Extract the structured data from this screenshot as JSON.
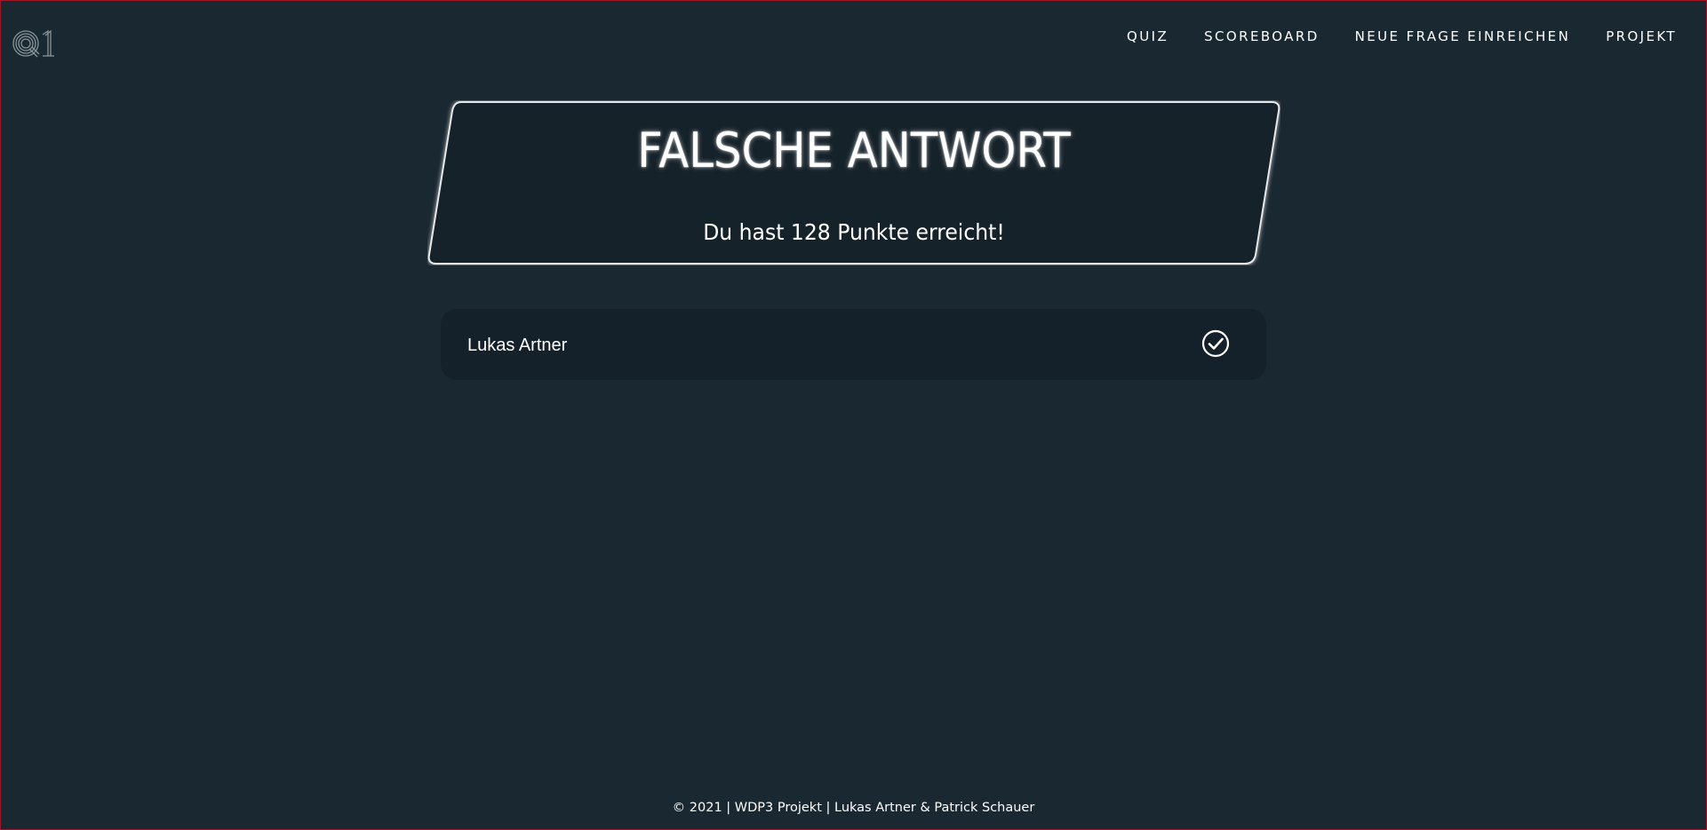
{
  "logo": {
    "icon": "q1-logo-icon",
    "text": "Q1"
  },
  "nav": {
    "items": [
      {
        "label": "QUIZ"
      },
      {
        "label": "SCOREBOARD"
      },
      {
        "label": "NEUE FRAGE EINREICHEN"
      },
      {
        "label": "PROJEKT"
      }
    ]
  },
  "result": {
    "title": "FALSCHE ANTWORT",
    "subtitle": "Du hast 128 Punkte erreicht!"
  },
  "name_form": {
    "value": "Lukas Artner",
    "placeholder": "",
    "submit_icon": "check-circle-icon"
  },
  "footer": {
    "text": "© 2021 | WDP3 Projekt | Lukas Artner & Patrick Schauer"
  },
  "colors": {
    "background": "#1a2832",
    "card_background": "#14202a",
    "input_background": "#15212a",
    "text": "#ffffff",
    "window_border": "#a01428"
  }
}
